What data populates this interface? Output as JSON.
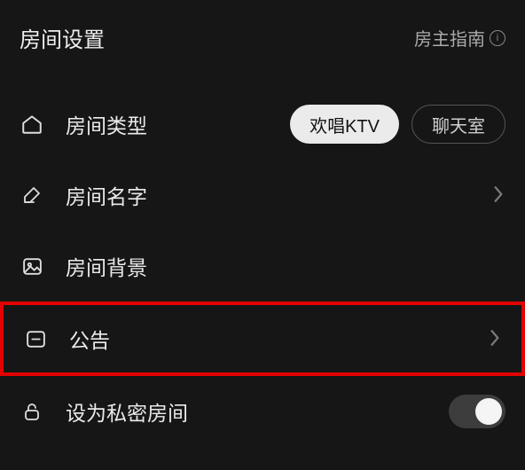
{
  "header": {
    "title": "房间设置",
    "guide_label": "房主指南"
  },
  "room_type": {
    "label": "房间类型",
    "option_active": "欢唱KTV",
    "option_inactive": "聊天室"
  },
  "room_name": {
    "label": "房间名字"
  },
  "room_bg": {
    "label": "房间背景"
  },
  "notice": {
    "label": "公告"
  },
  "private": {
    "label": "设为私密房间"
  }
}
